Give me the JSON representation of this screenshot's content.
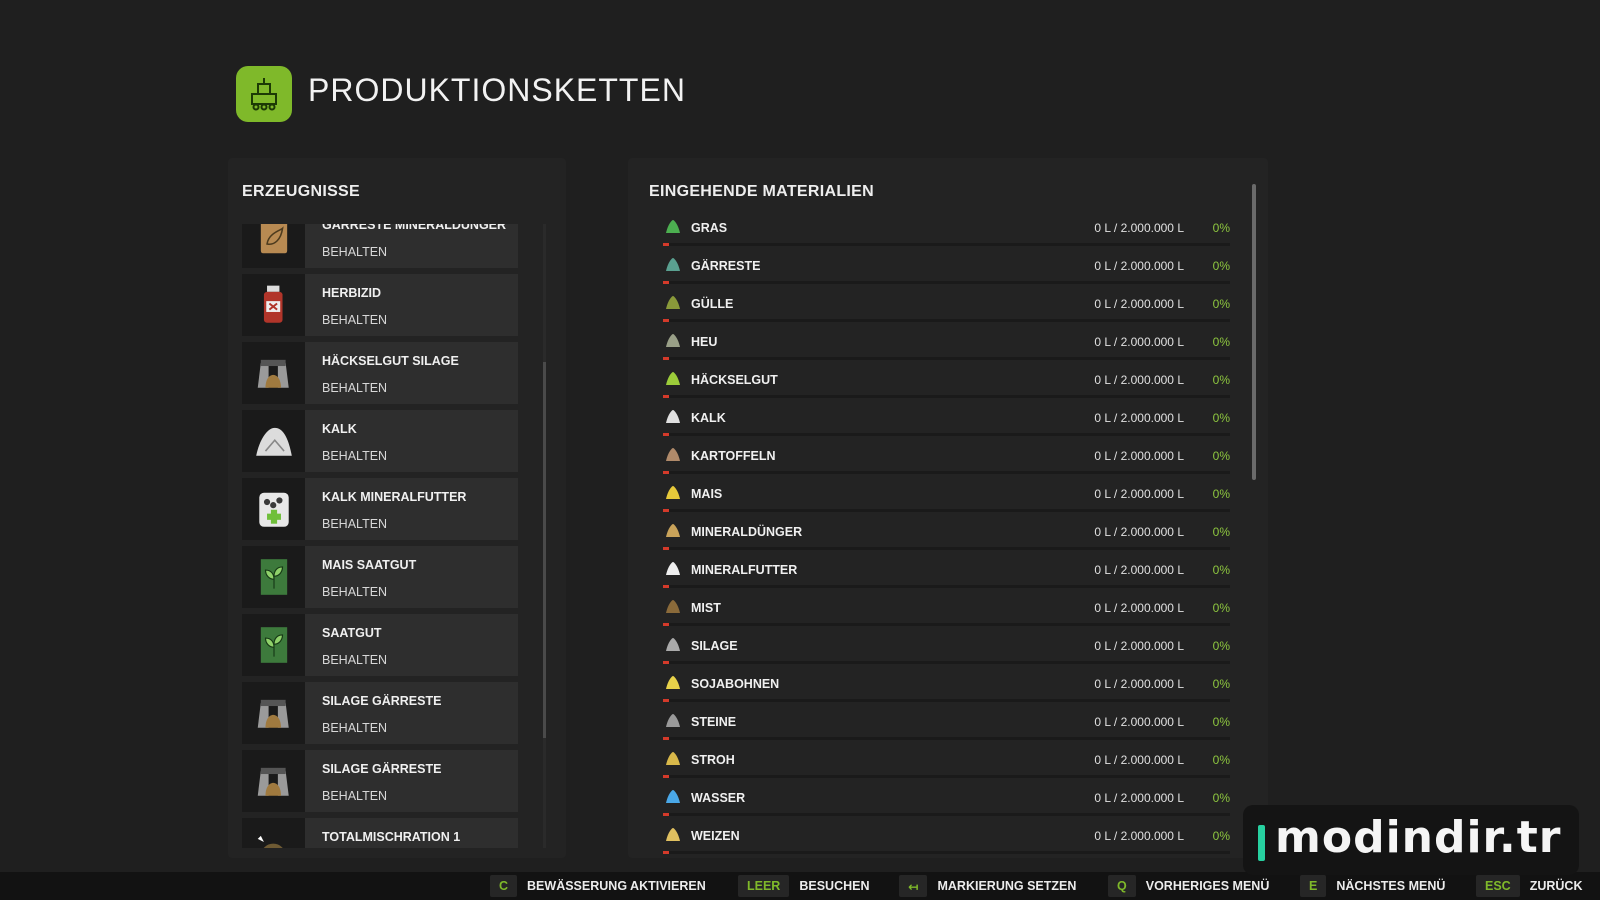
{
  "header": {
    "title": "PRODUKTIONSKETTEN",
    "icon": "production-chain-icon",
    "accent": "#7fb92a"
  },
  "products": {
    "heading": "ERZEUGNISSE",
    "items": [
      {
        "name": "GÄRRESTE MINERALDÜNGER",
        "status": "BEHALTEN",
        "icon": "fertilizer-bag-icon"
      },
      {
        "name": "HERBIZID",
        "status": "BEHALTEN",
        "icon": "herbicide-bottle-icon"
      },
      {
        "name": "HÄCKSELGUT SILAGE",
        "status": "BEHALTEN",
        "icon": "silage-bunker-icon"
      },
      {
        "name": "KALK",
        "status": "BEHALTEN",
        "icon": "lime-pile-icon"
      },
      {
        "name": "KALK MINERALFUTTER",
        "status": "BEHALTEN",
        "icon": "mineral-feed-bag-icon"
      },
      {
        "name": "MAIS SAATGUT",
        "status": "BEHALTEN",
        "icon": "seed-bag-icon"
      },
      {
        "name": "SAATGUT",
        "status": "BEHALTEN",
        "icon": "seed-bag-icon"
      },
      {
        "name": "SILAGE GÄRRESTE",
        "status": "BEHALTEN",
        "icon": "silage-bunker-icon"
      },
      {
        "name": "SILAGE GÄRRESTE",
        "status": "BEHALTEN",
        "icon": "silage-bunker-icon"
      },
      {
        "name": "TOTALMISCHRATION 1",
        "status": "",
        "icon": "mixed-ration-icon"
      }
    ]
  },
  "materials": {
    "heading": "EINGEHENDE MATERIALIEN",
    "percent_color": "#8dc63f",
    "bar_color": "#d43a2a",
    "items": [
      {
        "name": "GRAS",
        "amount": "0 L / 2.000.000 L",
        "percent": "0%",
        "fill": 0,
        "icon": "grass-icon"
      },
      {
        "name": "GÄRRESTE",
        "amount": "0 L / 2.000.000 L",
        "percent": "0%",
        "fill": 0,
        "icon": "digestate-icon"
      },
      {
        "name": "GÜLLE",
        "amount": "0 L / 2.000.000 L",
        "percent": "0%",
        "fill": 0,
        "icon": "slurry-icon"
      },
      {
        "name": "HEU",
        "amount": "0 L / 2.000.000 L",
        "percent": "0%",
        "fill": 0,
        "icon": "hay-icon"
      },
      {
        "name": "HÄCKSELGUT",
        "amount": "0 L / 2.000.000 L",
        "percent": "0%",
        "fill": 0,
        "icon": "chaff-icon"
      },
      {
        "name": "KALK",
        "amount": "0 L / 2.000.000 L",
        "percent": "0%",
        "fill": 0,
        "icon": "lime-icon"
      },
      {
        "name": "KARTOFFELN",
        "amount": "0 L / 2.000.000 L",
        "percent": "0%",
        "fill": 0,
        "icon": "potato-icon"
      },
      {
        "name": "MAIS",
        "amount": "0 L / 2.000.000 L",
        "percent": "0%",
        "fill": 0,
        "icon": "maize-icon"
      },
      {
        "name": "MINERALDÜNGER",
        "amount": "0 L / 2.000.000 L",
        "percent": "0%",
        "fill": 0,
        "icon": "fertilizer-icon"
      },
      {
        "name": "MINERALFUTTER",
        "amount": "0 L / 2.000.000 L",
        "percent": "0%",
        "fill": 0,
        "icon": "mineral-feed-icon"
      },
      {
        "name": "MIST",
        "amount": "0 L / 2.000.000 L",
        "percent": "0%",
        "fill": 0,
        "icon": "manure-icon"
      },
      {
        "name": "SILAGE",
        "amount": "0 L / 2.000.000 L",
        "percent": "0%",
        "fill": 0,
        "icon": "silage-icon"
      },
      {
        "name": "SOJABOHNEN",
        "amount": "0 L / 2.000.000 L",
        "percent": "0%",
        "fill": 0,
        "icon": "soybean-icon"
      },
      {
        "name": "STEINE",
        "amount": "0 L / 2.000.000 L",
        "percent": "0%",
        "fill": 0,
        "icon": "stones-icon"
      },
      {
        "name": "STROH",
        "amount": "0 L / 2.000.000 L",
        "percent": "0%",
        "fill": 0,
        "icon": "straw-icon"
      },
      {
        "name": "WASSER",
        "amount": "0 L / 2.000.000 L",
        "percent": "0%",
        "fill": 0,
        "icon": "water-icon"
      },
      {
        "name": "WEIZEN",
        "amount": "0 L / 2.000.000 L",
        "percent": "0%",
        "fill": 0,
        "icon": "wheat-icon"
      }
    ]
  },
  "bottom_bar": {
    "hints": [
      {
        "key": "C",
        "label": "BEWÄSSERUNG AKTIVIEREN"
      },
      {
        "key": "LEER",
        "label": "BESUCHEN"
      },
      {
        "key": "↤",
        "label": "MARKIERUNG SETZEN"
      },
      {
        "key": "Q",
        "label": "VORHERIGES MENÜ"
      },
      {
        "key": "E",
        "label": "NÄCHSTES MENÜ"
      },
      {
        "key": "ESC",
        "label": "ZURÜCK"
      }
    ]
  },
  "watermark": {
    "text": "modindir.tr"
  }
}
